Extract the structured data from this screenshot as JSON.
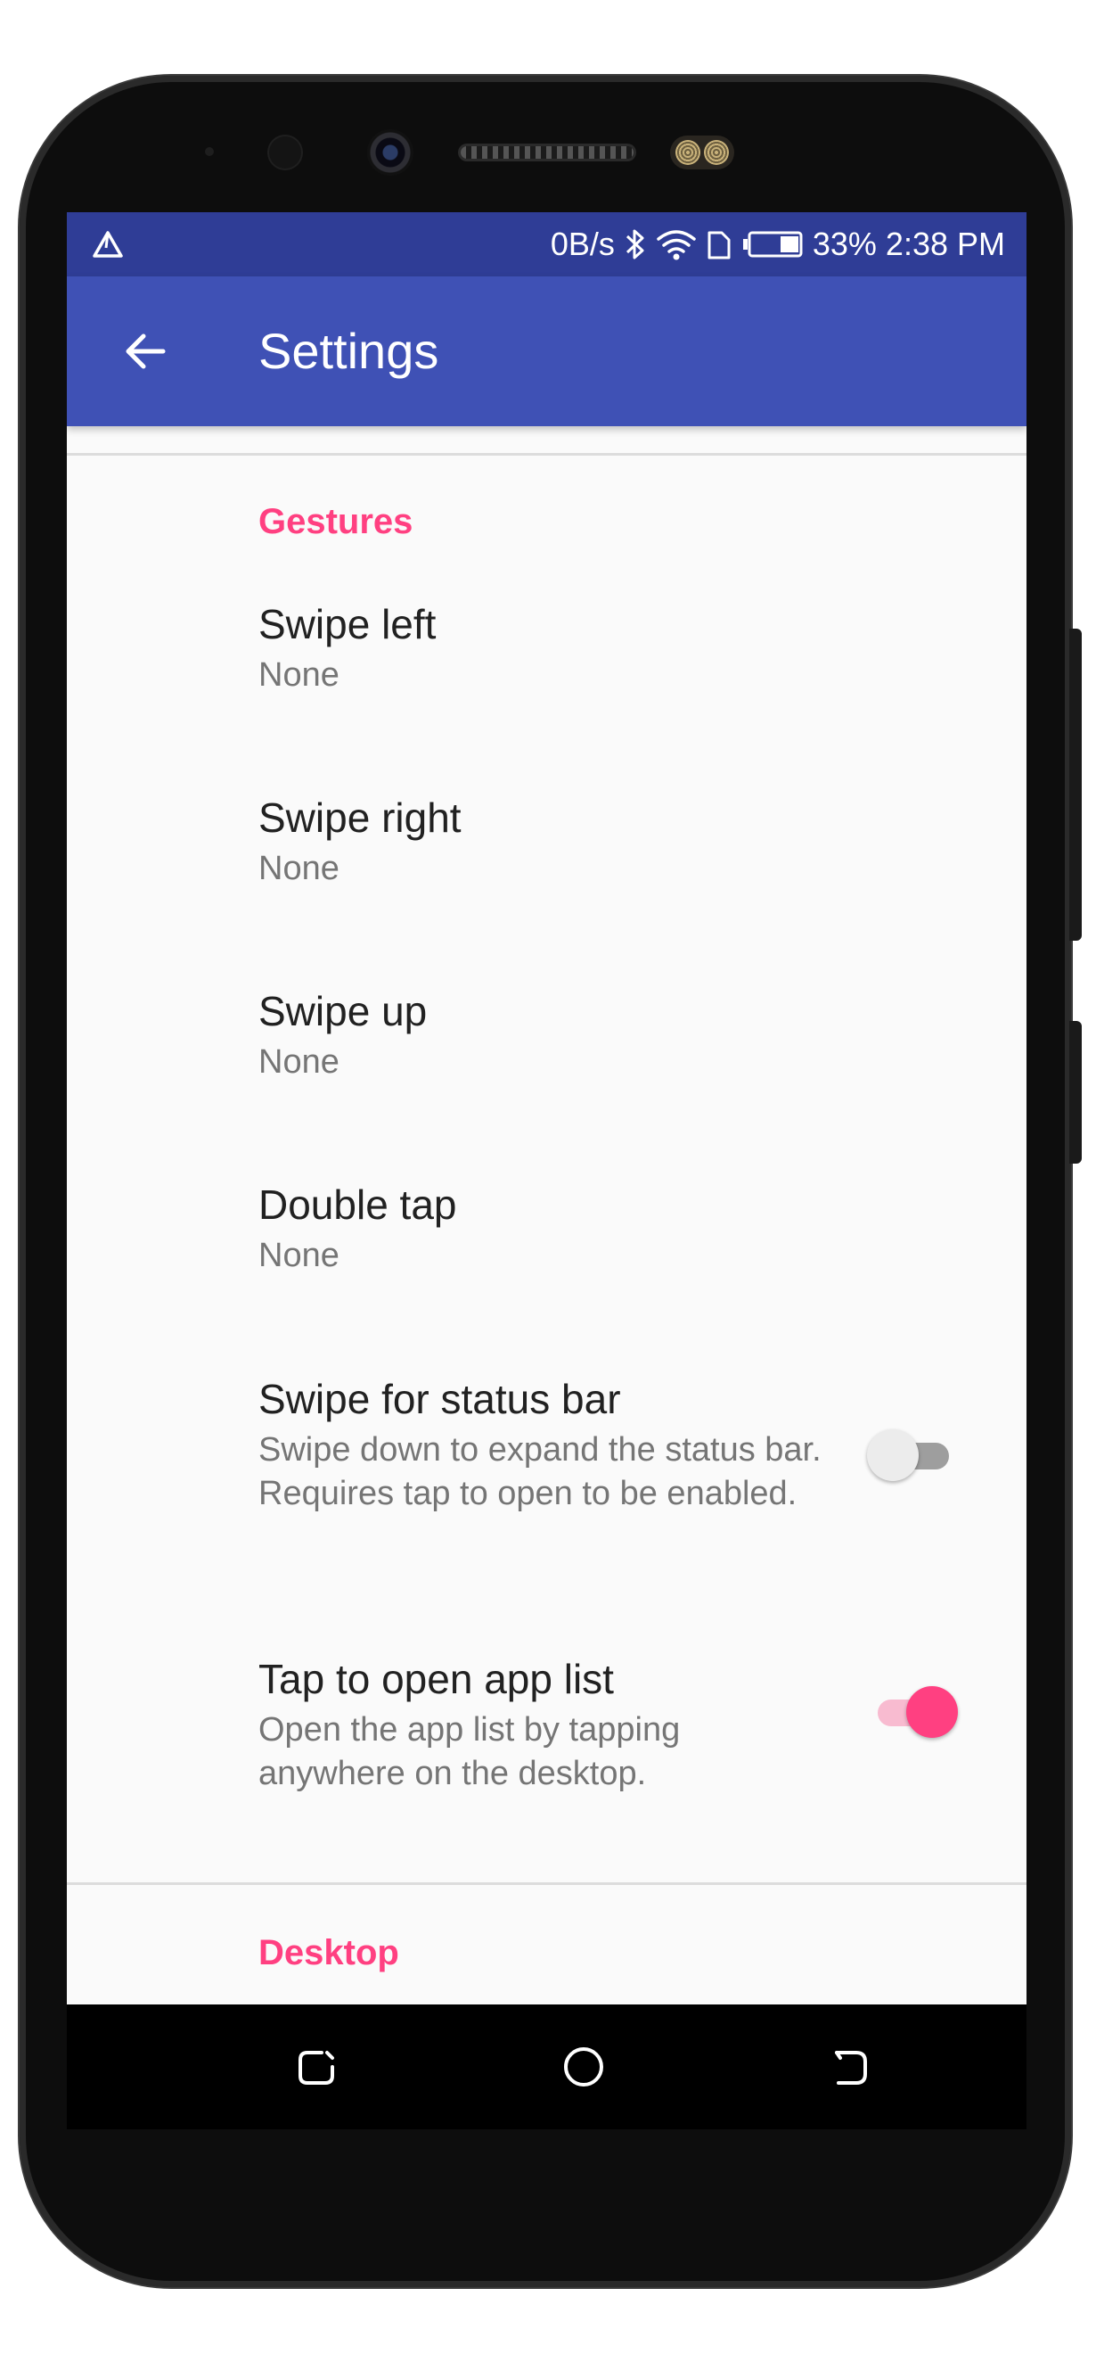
{
  "status_bar": {
    "network_speed": "0B/s",
    "battery_percent": "33%",
    "time": "2:38 PM",
    "icons": [
      "notification-triangle-icon",
      "bluetooth-icon",
      "wifi-icon",
      "sim-icon",
      "battery-icon"
    ]
  },
  "app_bar": {
    "title": "Settings",
    "back_icon": "arrow-left-icon"
  },
  "sections": [
    {
      "title": "Gestures",
      "items": [
        {
          "title": "Swipe left",
          "summary": "None"
        },
        {
          "title": "Swipe right",
          "summary": "None"
        },
        {
          "title": "Swipe up",
          "summary": "None"
        },
        {
          "title": "Double tap",
          "summary": "None"
        },
        {
          "title": "Swipe for status bar",
          "summary": "Swipe down to expand the status bar. Requires tap to open to be enabled.",
          "switch_on": false
        },
        {
          "title": "Tap to open app list",
          "summary": "Open the app list by tapping anywhere on the desktop.",
          "switch_on": true
        }
      ]
    },
    {
      "title": "Desktop",
      "items": []
    }
  ],
  "nav_bar": {
    "icons": [
      "back-nav-icon",
      "home-nav-icon",
      "recents-nav-icon"
    ]
  },
  "colors": {
    "status_bar": "#2f3d96",
    "app_bar": "#3f51b5",
    "accent": "#ff4081",
    "background": "#fafafa"
  }
}
